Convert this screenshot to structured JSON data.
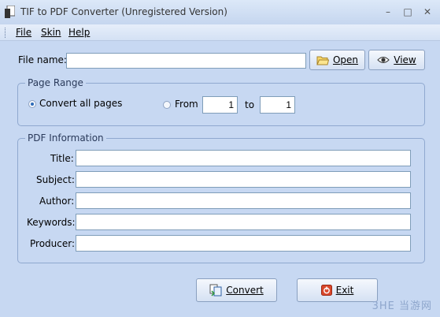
{
  "window": {
    "title": "TIF to PDF Converter (Unregistered Version)"
  },
  "menu": {
    "file": "File",
    "skin": "Skin",
    "help": "Help"
  },
  "file": {
    "label": "File name:",
    "value": "",
    "open_label": "Open",
    "view_label": "View"
  },
  "page_range": {
    "legend": "Page Range",
    "all_label": "Convert all pages",
    "from_label": "From",
    "from_value": "1",
    "to_label": "to",
    "to_value": "1",
    "selected": "all"
  },
  "pdf_info": {
    "legend": "PDF Information",
    "fields": [
      {
        "label": "Title:",
        "value": ""
      },
      {
        "label": "Subject:",
        "value": ""
      },
      {
        "label": "Author:",
        "value": ""
      },
      {
        "label": "Keywords:",
        "value": ""
      },
      {
        "label": "Producer:",
        "value": ""
      }
    ]
  },
  "actions": {
    "convert_label": "Convert",
    "exit_label": "Exit"
  },
  "watermark": "3HE 当游网"
}
